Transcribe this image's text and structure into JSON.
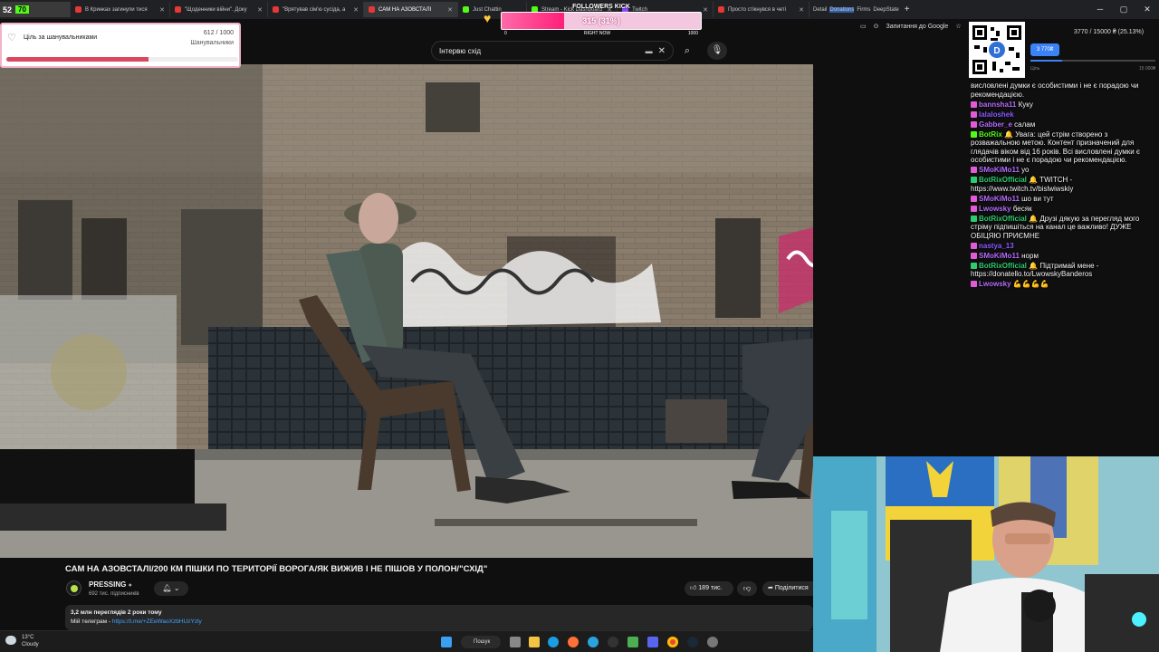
{
  "browser": {
    "tabs": [
      {
        "label": "52",
        "badge": "70"
      },
      {
        "label": "В Кринках загинули тися"
      },
      {
        "label": "\"Щоденники війни\". Доку"
      },
      {
        "label": "\"Врятував сім'ю сусіда, а"
      },
      {
        "label": "САМ НА АЗОВСТАЛІ"
      },
      {
        "label": "Just Chattin"
      },
      {
        "label": "Stream - Kick Dashboard"
      },
      {
        "label": "Twitch"
      },
      {
        "label": "Просто стікнувся в четі"
      }
    ],
    "pills": [
      "Detail",
      "Donations",
      "Firms",
      "DeepState"
    ],
    "address_right_label": "Запитання до Google"
  },
  "search": {
    "value": "Інтервю схід"
  },
  "kick_followers": {
    "title": "FOLLOWERS KICK",
    "value_text": "315 (31%)",
    "progress": 0.315,
    "min_label": "0",
    "mid_label": "RIGHT NOW",
    "max_label": "1000"
  },
  "goal": {
    "title": "Ціль за шанувальниками",
    "value_text": "612 / 1000",
    "subtitle": "Шанувальники",
    "progress": 0.612
  },
  "donation": {
    "top_text": "3770 / 15000 ₴ (25.13%)",
    "button": "3 770₴",
    "left_label": "Ціль",
    "max_label": "15 000₴",
    "progress": 0.2513
  },
  "video": {
    "title": "САМ НА АЗОВСТАЛІ/200 КМ ПІШКИ ПО ТЕРИТОРІЇ ВОРОГА/ЯК ВИЖИВ І НЕ ПІШОВ У ПОЛОН/\"СХІД\"",
    "channel": "PRESSING",
    "subscribers": "692 тис. підписників",
    "likes": "189 тис.",
    "share": "Поділитися",
    "views_line": "3,2 млн переглядів  2 роки тому",
    "telegram_label": "Мій телеграм -",
    "telegram_link": "https://t.me/+ZEeWaoXzbHUzYzly"
  },
  "chat": {
    "messages": [
      {
        "user": "",
        "text": "висловлені думки є особистими і не є порадою чи рекомендацією.",
        "color": "#ffffff"
      },
      {
        "user": "bannsha11",
        "text": "Куку",
        "color": "#b56cff"
      },
      {
        "user": "lalaloshek",
        "text": "",
        "color": "#8a5cff"
      },
      {
        "user": "Gabber_e",
        "text": "салам",
        "color": "#b56cff"
      },
      {
        "user": "BotRix",
        "text": "🔔 Увага: цей стрім створено з розважальною метою. Контент призначений для глядачів віком від 16 років. Всі висловлені думки є особистими і не є порадою чи рекомендацією.",
        "color": "#53fc18"
      },
      {
        "user": "SMoKiMo11",
        "text": "уо",
        "color": "#b56cff"
      },
      {
        "user": "BotRixOfficial",
        "text": "🔔 TWITCH - https://www.twitch.tv/bislwiwskiy",
        "color": "#2ecc71"
      },
      {
        "user": "SMoKiMo11",
        "text": "шо ви тут",
        "color": "#b56cff"
      },
      {
        "user": "Lwowsky",
        "text": "бесяк",
        "color": "#b56cff"
      },
      {
        "user": "BotRixOfficial",
        "text": "🔔 Друзі дякую за перегляд мого стріму підпишіться на канал це важливо! ДУЖЕ ОБІЦЯЮ ПРИЄМНЕ",
        "color": "#2ecc71"
      },
      {
        "user": "nastya_13",
        "text": "",
        "color": "#8a5cff"
      },
      {
        "user": "SMoKiMo11",
        "text": "норм",
        "color": "#b56cff"
      },
      {
        "user": "BotRixOfficial",
        "text": "🔔 Підтримай мене - https://donatello.to/LwowskyBanderos",
        "color": "#2ecc71"
      },
      {
        "user": "Lwowsky",
        "text": "💪💪💪💪",
        "color": "#b56cff"
      }
    ]
  },
  "taskbar": {
    "temp": "13°C",
    "weather": "Cloudy",
    "search_label": "Пошук"
  },
  "colors": {
    "kick_green": "#53fc18",
    "goal_red": "#d9485f",
    "yt_bg": "#0f0f0f"
  }
}
